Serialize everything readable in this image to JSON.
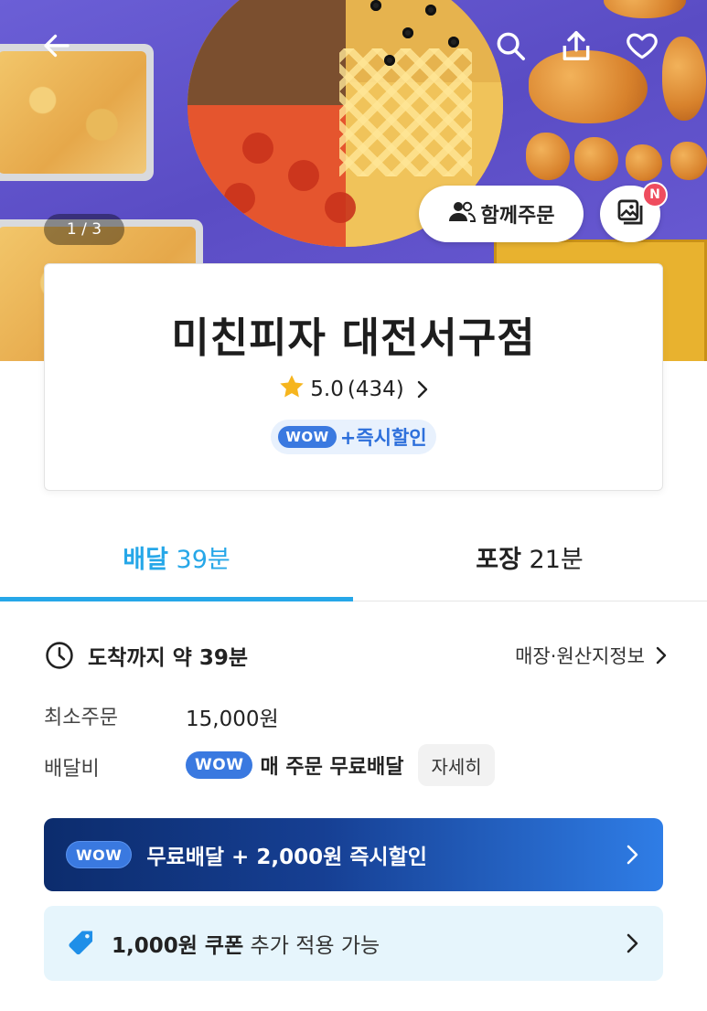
{
  "hero": {
    "image_counter": "1 / 3",
    "group_order_label": "함께주문",
    "new_badge": "N",
    "icons": [
      "back-arrow-icon",
      "search-icon",
      "share-icon",
      "heart-icon",
      "people-icon",
      "photo-gallery-icon"
    ]
  },
  "store": {
    "name": "미친피자 대전서구점",
    "rating": "5.0",
    "review_count": "(434)",
    "wow_badge": "WOW",
    "wow_promo": "+즉시할인"
  },
  "tabs": [
    {
      "label": "배달",
      "time": "39분",
      "active": true
    },
    {
      "label": "포장",
      "time": "21분",
      "active": false
    }
  ],
  "info": {
    "eta_label": "도착까지 약 39분",
    "store_info_link": "매장·원산지정보",
    "min_order_label": "최소주문",
    "min_order_value": "15,000원",
    "delivery_fee_label": "배달비",
    "delivery_fee_wow": "WOW",
    "delivery_fee_value": "매 주문 무료배달",
    "detail_button": "자세히"
  },
  "banners": {
    "wow_badge": "WOW",
    "wow_text": "무료배달 + 2,000원 즉시할인",
    "coupon_bold": "1,000원 쿠폰",
    "coupon_text": " 추가 적용 가능"
  },
  "colors": {
    "accent": "#26a7e8",
    "wow_blue": "#3a79e0",
    "banner_dark": "#0c2c6d",
    "coupon_bg": "#e6f5fc"
  }
}
